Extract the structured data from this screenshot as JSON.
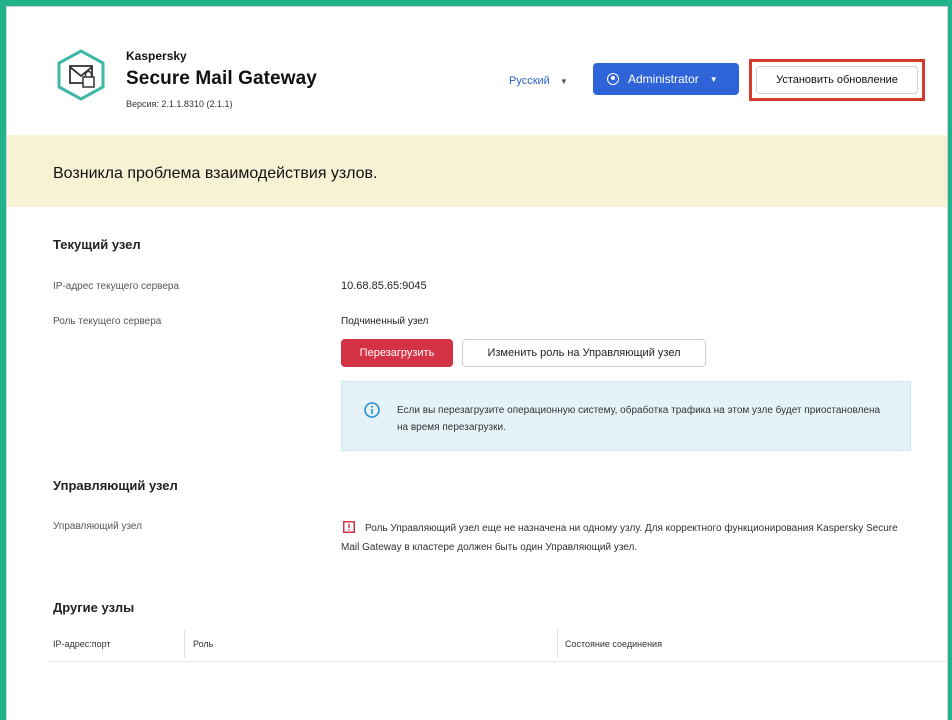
{
  "header": {
    "brand_small": "Kaspersky",
    "brand_title": "Secure Mail Gateway",
    "version": "Версия: 2.1.1.8310 (2.1.1)",
    "language": "Русский",
    "admin_label": "Administrator",
    "install_update_label": "Установить обновление"
  },
  "banner": {
    "text": "Возникла проблема взаимодействия узлов."
  },
  "current_node": {
    "title": "Текущий узел",
    "ip_label": "IP-адрес текущего сервера",
    "ip_value": "10.68.85.65:9045",
    "role_label": "Роль текущего сервера",
    "role_value": "Подчиненный узел",
    "reboot_button": "Перезагрузить",
    "change_role_button": "Изменить роль на Управляющий узел",
    "info_text": "Если вы перезагрузите операционную систему, обработка трафика на этом узле будет приостановлена на время перезагрузки."
  },
  "control_node": {
    "title": "Управляющий узел",
    "label": "Управляющий узел",
    "warning_text": "Роль Управляющий узел еще не назначена ни одному узлу. Для корректного функционирования Kaspersky Secure Mail Gateway в кластере должен быть один Управляющий узел."
  },
  "other_nodes": {
    "title": "Другие узлы",
    "columns": [
      "IP-адрес:порт",
      "Роль",
      "Состояние соединения"
    ]
  },
  "colors": {
    "frame": "#22b38a",
    "accent_blue": "#2f63d8",
    "danger_red": "#d33345",
    "highlight_red": "#d33a2c",
    "banner_bg": "#f8f2d4",
    "info_bg": "#e5f3f8",
    "logo_teal": "#3fb8a5"
  },
  "icons": {
    "logo": "mail-shield-icon",
    "admin": "user-circle-icon",
    "info": "info-icon",
    "warning": "warning-icon"
  }
}
